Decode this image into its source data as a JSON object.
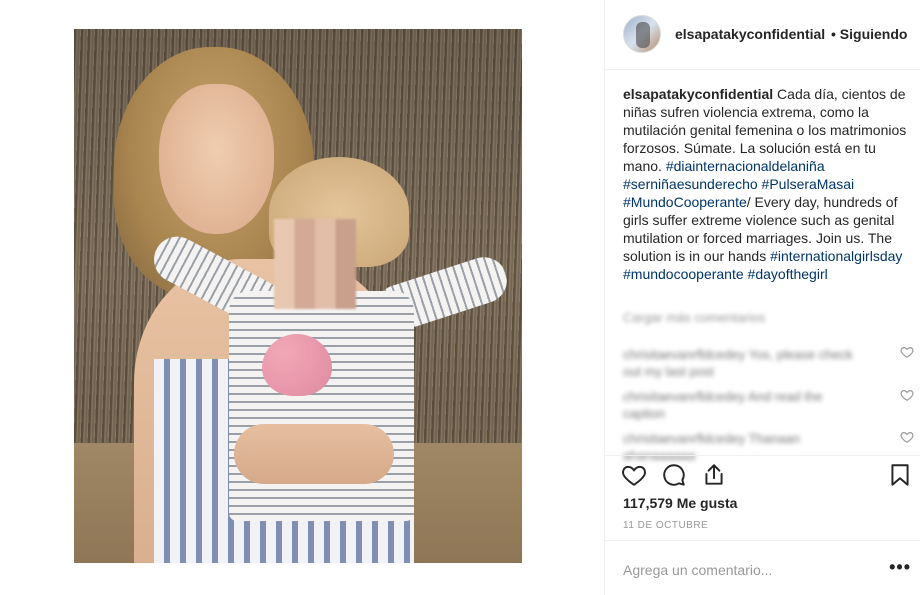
{
  "post": {
    "username": "elsapatakyconfidential",
    "follow_separator": "•",
    "follow_status": "Siguiendo"
  },
  "caption": {
    "username": "elsapatakyconfidential",
    "text_1": " Cada día, cientos de niñas sufren violencia extrema, como la mutilación genital femenina o los matrimonios forzosos. Súmate. La solución está en tu mano. ",
    "tag_1": "#diainternacionaldelaniña",
    "tag_2": "#serniñaesunderecho",
    "tag_3": "#PulseraMasai",
    "tag_4": "#MundoCooperante",
    "text_2": "/ Every day, hundreds of girls suffer extreme violence such as genital mutilation or forced marriages. Join us. The solution is in our hands ",
    "tag_5": "#internationalgirlsday",
    "tag_6": "#mundocooperante",
    "tag_7": "#dayofthegirl"
  },
  "comments": {
    "load_more": "Cargar más comentarios",
    "items": [
      {
        "text": "chrisitaevanrfldcedey Yos, please check out my last post"
      },
      {
        "text": "chrisitaevanrfldcedey And read the caption"
      },
      {
        "text": "chrisitaevanrfldcedey Thanaan ahanaaaaaa"
      }
    ]
  },
  "engagement": {
    "likes": "117,579 Me gusta",
    "date": "11 DE OCTUBRE"
  },
  "comment_box": {
    "placeholder": "Agrega un comentario...",
    "more_label": "•••"
  },
  "icons": {
    "like": "heart-icon",
    "comment": "comment-icon",
    "share": "share-icon",
    "save": "bookmark-icon",
    "comment_like": "heart-outline-icon"
  }
}
